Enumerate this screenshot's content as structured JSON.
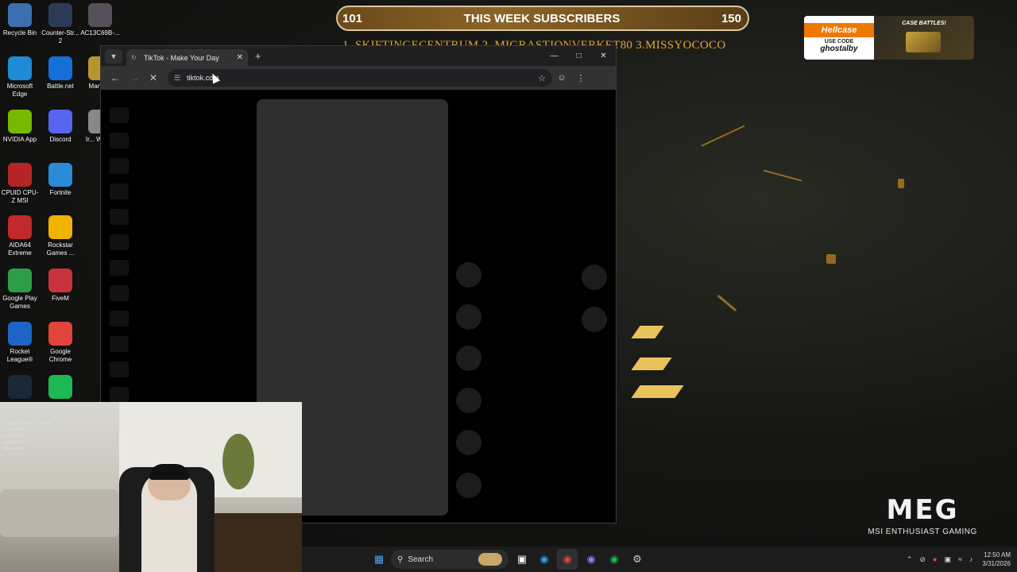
{
  "desktop": {
    "icons": [
      {
        "label": "Recycle Bin",
        "icon": "recycle-bin-icon",
        "color": "#3b6fb0"
      },
      {
        "label": "Counter-Str... 2",
        "icon": "counter-strike-icon",
        "color": "#2c3b55"
      },
      {
        "label": "AC13C69B-...",
        "icon": "file-icon",
        "color": "#55505a"
      },
      {
        "label": "Microsoft Edge",
        "icon": "edge-icon",
        "color": "#1e8bd6"
      },
      {
        "label": "Battle.net",
        "icon": "battlenet-icon",
        "color": "#1470d8"
      },
      {
        "label": "Marve...",
        "icon": "marvel-icon",
        "color": "#b8962f"
      },
      {
        "label": "NVIDIA App",
        "icon": "nvidia-icon",
        "color": "#76b900"
      },
      {
        "label": "Discord",
        "icon": "discord-icon",
        "color": "#5865f2"
      },
      {
        "label": "Ir... Web...",
        "icon": "web-icon",
        "color": "#888888"
      },
      {
        "label": "CPUID CPU-Z MSI",
        "icon": "cpuz-icon",
        "color": "#b62525"
      },
      {
        "label": "Fortnite",
        "icon": "fortnite-icon",
        "color": "#2a8bd8"
      },
      {
        "label": "AIDA64 Extreme",
        "icon": "aida64-icon",
        "color": "#c02a2a"
      },
      {
        "label": "Rockstar Games ...",
        "icon": "rockstar-icon",
        "color": "#f0b400"
      },
      {
        "label": "Google Play Games",
        "icon": "google-play-games-icon",
        "color": "#2e9d4a"
      },
      {
        "label": "FiveM",
        "icon": "fivem-icon",
        "color": "#c8323c"
      },
      {
        "label": "Rocket League®",
        "icon": "rocket-league-icon",
        "color": "#1d64c4"
      },
      {
        "label": "Google Chrome",
        "icon": "chrome-icon",
        "color": "#e0443a"
      },
      {
        "label": "",
        "icon": "steam-icon",
        "color": "#1b2838"
      },
      {
        "label": "",
        "icon": "spotify-icon",
        "color": "#1db954"
      }
    ]
  },
  "overlay": {
    "sub_left": "101",
    "sub_title": "THIS WEEK SUBSCRIBERS",
    "sub_right": "150",
    "ticker": "1. SKIFTINGECENTRUM  2. MIGRASTIONVERKET80 3.MISSYOCOCO",
    "hellcase_brand": "Hellcase",
    "hellcase_code_label": "USE CODE",
    "hellcase_code": "ghostalby",
    "hellcase_promo": "CASE BATTLES!",
    "meg_logo": "MEG",
    "meg_sub": "MSI ENTHUSIAST GAMING"
  },
  "browser": {
    "tab_title": "TikTok - Make Your Day",
    "url": "tiktok.com",
    "loading": true
  },
  "webcam": {
    "chat": [
      "Migrastionverket80 : ♥♥♥♥♥",
      "ozzzee1788 : ☺",
      "ozzzee1788 : ☺",
      "ozzzee1788 : ☺",
      "bambudorhi"
    ]
  },
  "taskbar": {
    "search_label": "Search",
    "time": "12:50 AM",
    "date": "3/31/2026"
  },
  "colors": {
    "accent_gold": "#e0a63a",
    "hellcase_orange": "#f07800"
  }
}
